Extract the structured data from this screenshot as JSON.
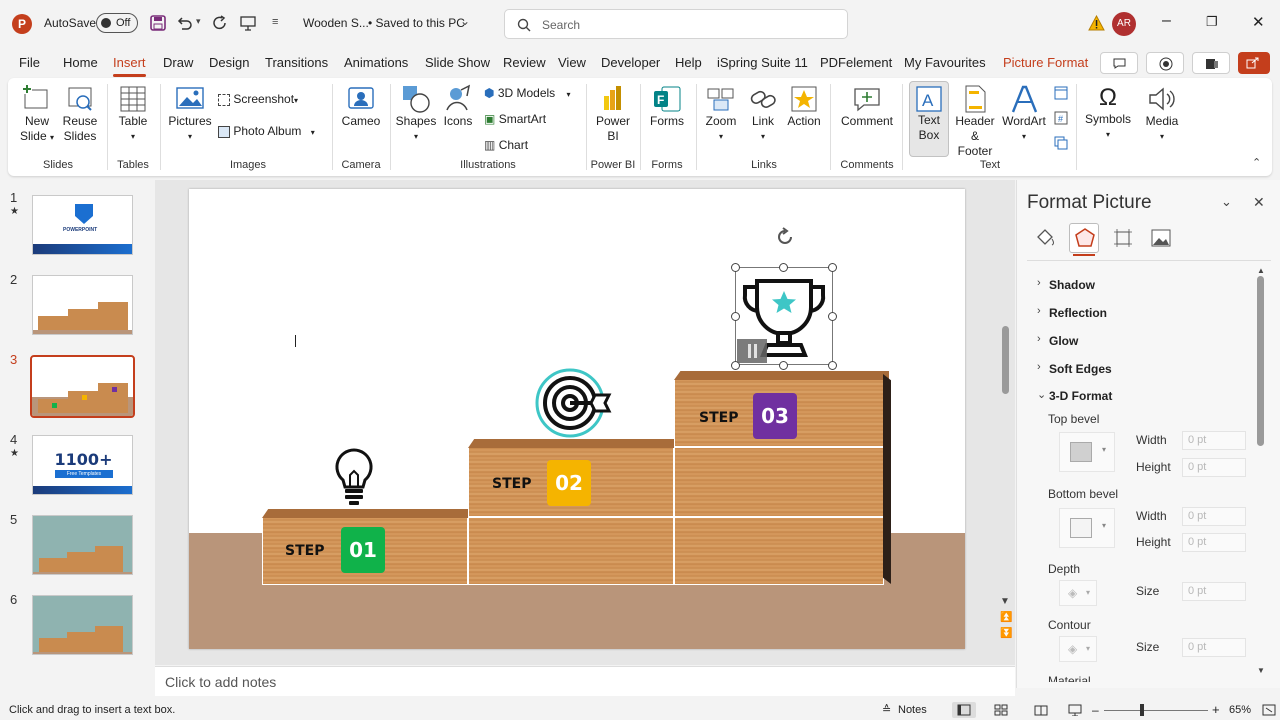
{
  "titlebar": {
    "autosave_label": "AutoSave",
    "autosave_state": "Off",
    "doc_title": "Wooden S...",
    "save_status": "• Saved to this PC",
    "search_placeholder": "Search",
    "avatar_initials": "AR"
  },
  "menu": [
    "File",
    "Home",
    "Insert",
    "Draw",
    "Design",
    "Transitions",
    "Animations",
    "Slide Show",
    "Review",
    "View",
    "Developer",
    "Help",
    "iSpring Suite 11",
    "PDFelement",
    "My Favourites",
    "Picture Format"
  ],
  "ribbon": {
    "new_slide": [
      "New",
      "Slide"
    ],
    "reuse_slides": [
      "Reuse",
      "Slides"
    ],
    "table": "Table",
    "pictures": "Pictures",
    "screenshot": "Screenshot",
    "photo_album": "Photo Album",
    "cameo": "Cameo",
    "shapes": "Shapes",
    "icons": "Icons",
    "models_3d": "3D Models",
    "smartart": "SmartArt",
    "chart": "Chart",
    "power_bi": [
      "Power",
      "BI"
    ],
    "forms": "Forms",
    "zoom": "Zoom",
    "link": "Link",
    "action": "Action",
    "comment": "Comment",
    "text_box": [
      "Text",
      "Box"
    ],
    "header_footer": [
      "Header",
      "& Footer"
    ],
    "wordart": "WordArt",
    "symbols": "Symbols",
    "media": "Media",
    "groups": {
      "slides": "Slides",
      "tables": "Tables",
      "images": "Images",
      "camera": "Camera",
      "illustrations": "Illustrations",
      "power_bi": "Power BI",
      "forms": "Forms",
      "links": "Links",
      "comments": "Comments",
      "text": "Text"
    }
  },
  "thumbnails": [
    {
      "num": "1",
      "star": "★",
      "title": "POWERPOINT"
    },
    {
      "num": "2",
      "star": ""
    },
    {
      "num": "3",
      "star": ""
    },
    {
      "num": "4",
      "star": "★",
      "big": "1100+",
      "sub": "Free Templates"
    },
    {
      "num": "5",
      "star": ""
    },
    {
      "num": "6",
      "star": ""
    }
  ],
  "slide": {
    "step_word": "STEP",
    "steps": [
      "01",
      "02",
      "03"
    ],
    "step_colors": [
      "#10b24a",
      "#f5b400",
      "#7030a0"
    ]
  },
  "format_pane": {
    "title": "Format Picture",
    "sections": [
      "Shadow",
      "Reflection",
      "Glow",
      "Soft Edges",
      "3-D Format"
    ],
    "top_bevel": "Top bevel",
    "bottom_bevel": "Bottom bevel",
    "width": "Width",
    "height": "Height",
    "depth": "Depth",
    "contour": "Contour",
    "size": "Size",
    "material": "Material",
    "zero_pt": "0 pt"
  },
  "notes_placeholder": "Click to add notes",
  "status": {
    "hint": "Click and drag to insert a text box.",
    "notes": "Notes",
    "zoom": "65%"
  }
}
